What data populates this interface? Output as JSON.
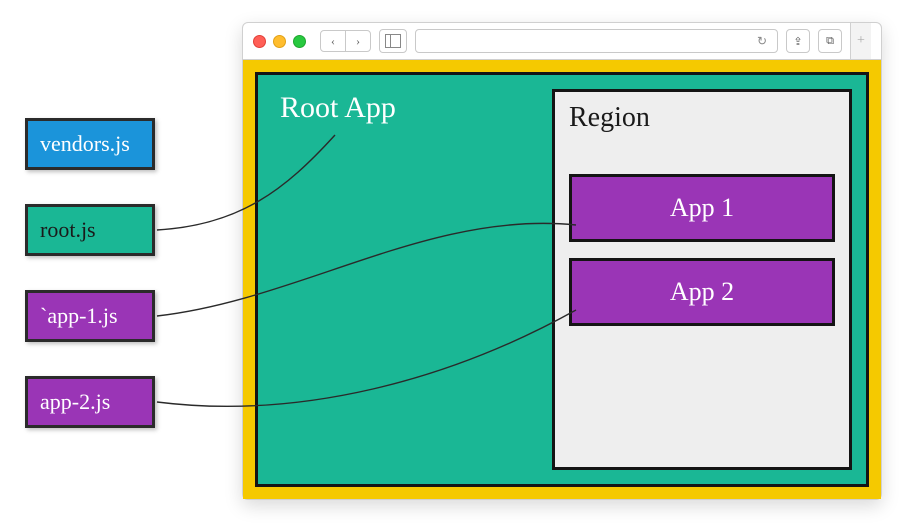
{
  "files": {
    "vendors": {
      "label": "vendors.js",
      "color": "#1b94da"
    },
    "root": {
      "label": "root.js",
      "color": "#1ab795"
    },
    "app1": {
      "label": "`app-1.js",
      "color": "#9a35b6"
    },
    "app2": {
      "label": "app-2.js",
      "color": "#9a35b6"
    }
  },
  "browser": {
    "url_reload_glyph": "↻",
    "back_glyph": "‹",
    "forward_glyph": "›",
    "share_glyph": "⇪",
    "tabs_glyph": "⧉",
    "plus_glyph": "+"
  },
  "diagram": {
    "root_label": "Root App",
    "region_label": "Region",
    "app1_label": "App 1",
    "app2_label": "App 2"
  },
  "colors": {
    "accent_yellow": "#f5c900",
    "accent_teal": "#1ab795",
    "accent_purple": "#9a35b6",
    "accent_blue": "#1b94da",
    "border_dark": "#141414"
  }
}
